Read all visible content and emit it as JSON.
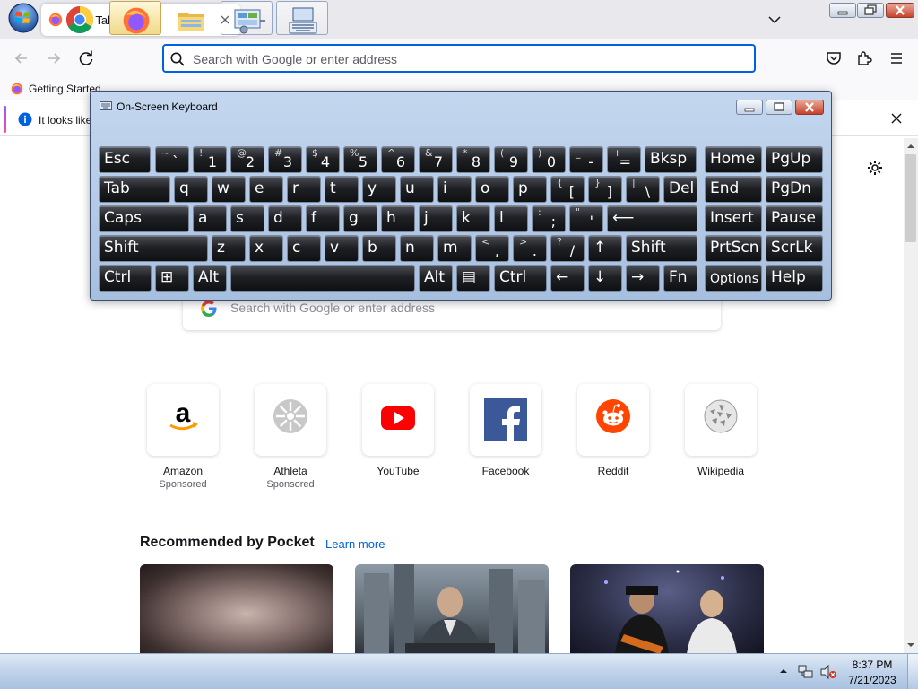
{
  "browser": {
    "tab": {
      "title": "New Tab"
    },
    "urlbar": {
      "placeholder": "Search with Google or enter address"
    },
    "bookmarks": [
      {
        "label": "Getting Started"
      }
    ],
    "notice": {
      "text": "It looks like"
    }
  },
  "page": {
    "search_placeholder": "Search with Google or enter address",
    "top_sites": [
      {
        "name": "Amazon",
        "sponsored": "Sponsored",
        "icon": "amazon-icon"
      },
      {
        "name": "Athleta",
        "sponsored": "Sponsored",
        "icon": "athleta-icon"
      },
      {
        "name": "YouTube",
        "sponsored": "",
        "icon": "youtube-icon"
      },
      {
        "name": "Facebook",
        "sponsored": "",
        "icon": "facebook-icon"
      },
      {
        "name": "Reddit",
        "sponsored": "",
        "icon": "reddit-icon"
      },
      {
        "name": "Wikipedia",
        "sponsored": "",
        "icon": "wikipedia-icon"
      }
    ],
    "pocket": {
      "heading": "Recommended by Pocket",
      "learn_more": "Learn more"
    }
  },
  "osk": {
    "title": "On-Screen Keyboard",
    "rows": [
      [
        {
          "label": "Esc",
          "name": "esc"
        },
        {
          "sub": "~",
          "main": "`",
          "name": "backtick"
        },
        {
          "sub": "!",
          "main": "1",
          "name": "1"
        },
        {
          "sub": "@",
          "main": "2",
          "name": "2"
        },
        {
          "sub": "#",
          "main": "3",
          "name": "3"
        },
        {
          "sub": "$",
          "main": "4",
          "name": "4"
        },
        {
          "sub": "%",
          "main": "5",
          "name": "5"
        },
        {
          "sub": "^",
          "main": "6",
          "name": "6"
        },
        {
          "sub": "&",
          "main": "7",
          "name": "7"
        },
        {
          "sub": "*",
          "main": "8",
          "name": "8"
        },
        {
          "sub": "(",
          "main": "9",
          "name": "9"
        },
        {
          "sub": ")",
          "main": "0",
          "name": "0"
        },
        {
          "sub": "_",
          "main": "-",
          "name": "minus"
        },
        {
          "sub": "+",
          "main": "=",
          "name": "equals"
        },
        {
          "label": "Bksp",
          "name": "backspace"
        },
        {
          "label": "Home",
          "name": "home"
        },
        {
          "label": "PgUp",
          "name": "pgup"
        }
      ],
      [
        {
          "label": "Tab",
          "name": "tab"
        },
        {
          "label": "q",
          "name": "q"
        },
        {
          "label": "w",
          "name": "w"
        },
        {
          "label": "e",
          "name": "e"
        },
        {
          "label": "r",
          "name": "r"
        },
        {
          "label": "t",
          "name": "t"
        },
        {
          "label": "y",
          "name": "y"
        },
        {
          "label": "u",
          "name": "u"
        },
        {
          "label": "i",
          "name": "i"
        },
        {
          "label": "o",
          "name": "o"
        },
        {
          "label": "p",
          "name": "p"
        },
        {
          "sub": "{",
          "main": "[",
          "name": "lbracket"
        },
        {
          "sub": "}",
          "main": "]",
          "name": "rbracket"
        },
        {
          "sub": "|",
          "main": "\\",
          "name": "backslash"
        },
        {
          "label": "Del",
          "name": "del"
        },
        {
          "label": "End",
          "name": "end"
        },
        {
          "label": "PgDn",
          "name": "pgdn"
        }
      ],
      [
        {
          "label": "Caps",
          "name": "caps"
        },
        {
          "label": "a",
          "name": "a"
        },
        {
          "label": "s",
          "name": "s"
        },
        {
          "label": "d",
          "name": "d"
        },
        {
          "label": "f",
          "name": "f"
        },
        {
          "label": "g",
          "name": "g"
        },
        {
          "label": "h",
          "name": "h"
        },
        {
          "label": "j",
          "name": "j"
        },
        {
          "label": "k",
          "name": "k"
        },
        {
          "label": "l",
          "name": "l"
        },
        {
          "sub": ":",
          "main": ";",
          "name": "semicolon"
        },
        {
          "sub": "\"",
          "main": "'",
          "name": "quote"
        },
        {
          "label": "⟵",
          "name": "enter"
        },
        {
          "label": "Insert",
          "name": "insert"
        },
        {
          "label": "Pause",
          "name": "pause"
        }
      ],
      [
        {
          "label": "Shift",
          "name": "shift-left"
        },
        {
          "label": "z",
          "name": "z"
        },
        {
          "label": "x",
          "name": "x"
        },
        {
          "label": "c",
          "name": "c"
        },
        {
          "label": "v",
          "name": "v"
        },
        {
          "label": "b",
          "name": "b"
        },
        {
          "label": "n",
          "name": "n"
        },
        {
          "label": "m",
          "name": "m"
        },
        {
          "sub": "<",
          "main": ",",
          "name": "comma"
        },
        {
          "sub": ">",
          "main": ".",
          "name": "period"
        },
        {
          "sub": "?",
          "main": "/",
          "name": "slash"
        },
        {
          "label": "↑",
          "name": "up"
        },
        {
          "label": "Shift",
          "name": "shift-right"
        },
        {
          "label": "PrtScn",
          "name": "prtscn"
        },
        {
          "label": "ScrLk",
          "name": "scrlk"
        }
      ],
      [
        {
          "label": "Ctrl",
          "name": "ctrl-left"
        },
        {
          "label": "⊞",
          "name": "win"
        },
        {
          "label": "Alt",
          "name": "alt-left"
        },
        {
          "label": "",
          "name": "space"
        },
        {
          "label": "Alt",
          "name": "alt-right"
        },
        {
          "label": "▤",
          "name": "menu"
        },
        {
          "label": "Ctrl",
          "name": "ctrl-right"
        },
        {
          "label": "←",
          "name": "left"
        },
        {
          "label": "↓",
          "name": "down"
        },
        {
          "label": "→",
          "name": "right"
        },
        {
          "label": "Fn",
          "name": "fn"
        },
        {
          "label": "Options",
          "name": "options"
        },
        {
          "label": "Help",
          "name": "help"
        }
      ]
    ]
  },
  "taskbar": {
    "items": [
      "chrome-icon",
      "firefox-icon",
      "explorer-icon",
      "control-panel-icon",
      "on-screen-keyboard-icon"
    ],
    "clock": {
      "time": "8:37 PM",
      "date": "7/21/2023"
    }
  },
  "colors": {
    "accent": "#0061e0",
    "key_face": "#1e2024"
  }
}
